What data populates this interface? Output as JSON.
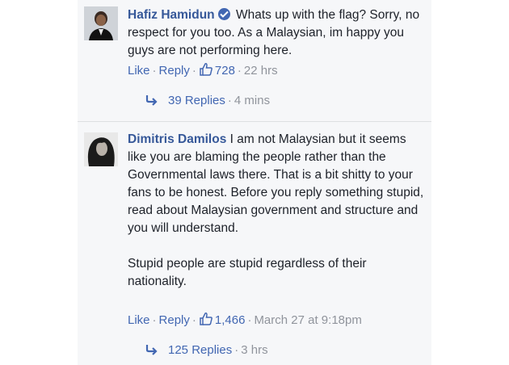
{
  "comments": [
    {
      "author": "Hafiz Hamidun",
      "verified": true,
      "text": "Whats up with the flag? Sorry, no respect for you too. As a Malaysian, im happy you guys are not performing here.",
      "actions": {
        "like": "Like",
        "reply": "Reply",
        "likes": "728",
        "time": "22 hrs"
      },
      "replies": {
        "label": "39 Replies",
        "time": "4 mins"
      }
    },
    {
      "author": "Dimitris Damilos",
      "verified": false,
      "text": "I am not Malaysian but it seems like you are blaming the people rather than the Governmental laws there. That is a bit shitty to your fans to be honest. Before you reply something stupid, read about Malaysian government and structure and you will understand.",
      "text2": "Stupid people are stupid regardless of their nationality.",
      "actions": {
        "like": "Like",
        "reply": "Reply",
        "likes": "1,466",
        "time": "March 27 at 9:18pm"
      },
      "replies": {
        "label": "125 Replies",
        "time": "3 hrs"
      }
    }
  ],
  "colors": {
    "link": "#4267b2",
    "author": "#365899",
    "meta": "#90949c",
    "panel": "#f6f7f9"
  },
  "icons": [
    "verified-badge-icon",
    "thumbs-up-icon",
    "reply-arrow-icon"
  ]
}
